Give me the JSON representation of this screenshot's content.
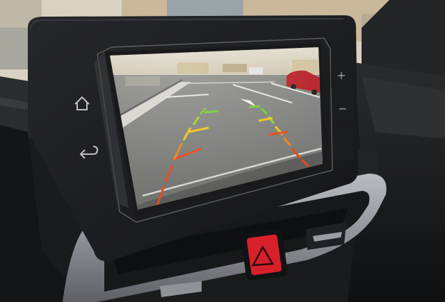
{
  "scene": {
    "description_free": true
  },
  "head_unit": {
    "left_buttons": [
      {
        "icon": "home-icon"
      },
      {
        "icon": "back-icon"
      }
    ],
    "right_buttons": [
      {
        "icon": "volume-up-icon",
        "glyph": "+"
      },
      {
        "icon": "volume-down-icon",
        "glyph": "−"
      }
    ]
  },
  "camera_view": {
    "guide_line_colors": {
      "near": "#e84a1c",
      "mid": "#f0c419",
      "far": "#6ecf2e"
    }
  },
  "dashboard": {
    "hazard_button_color": "#d8202a"
  }
}
